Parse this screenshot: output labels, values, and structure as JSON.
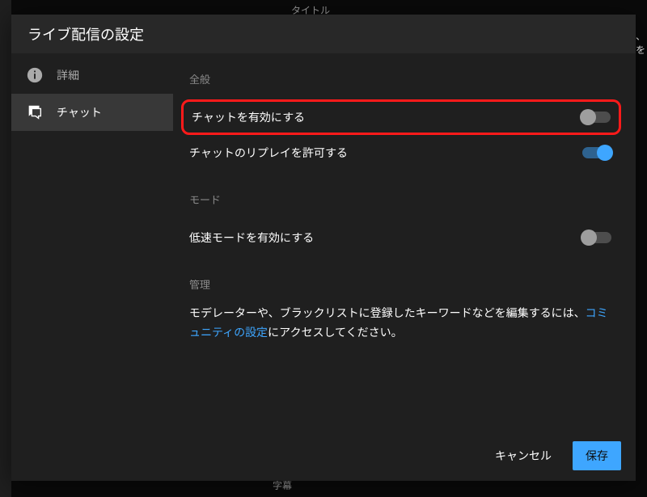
{
  "background": {
    "top_tab": "タイトル",
    "right_text_1": "！",
    "right_text_2": "　、",
    "right_text_3": "ンを",
    "subtitle_tab": "字幕"
  },
  "dialog": {
    "title": "ライブ配信の設定"
  },
  "nav": {
    "details": "詳細",
    "chat": "チャット"
  },
  "sections": {
    "general": "全般",
    "mode": "モード",
    "management": "管理"
  },
  "settings": {
    "enable_chat": "チャットを有効にする",
    "allow_replay": "チャットのリプレイを許可する",
    "slow_mode": "低速モードを有効にする"
  },
  "management_text": {
    "part1": "モデレーターや、ブラックリストに登録したキーワードなどを編集するには、",
    "link": "コミュニティの設定",
    "part2": "にアクセスしてください。"
  },
  "footer": {
    "cancel": "キャンセル",
    "save": "保存"
  },
  "toggles": {
    "enable_chat": false,
    "allow_replay": true,
    "slow_mode": false
  }
}
